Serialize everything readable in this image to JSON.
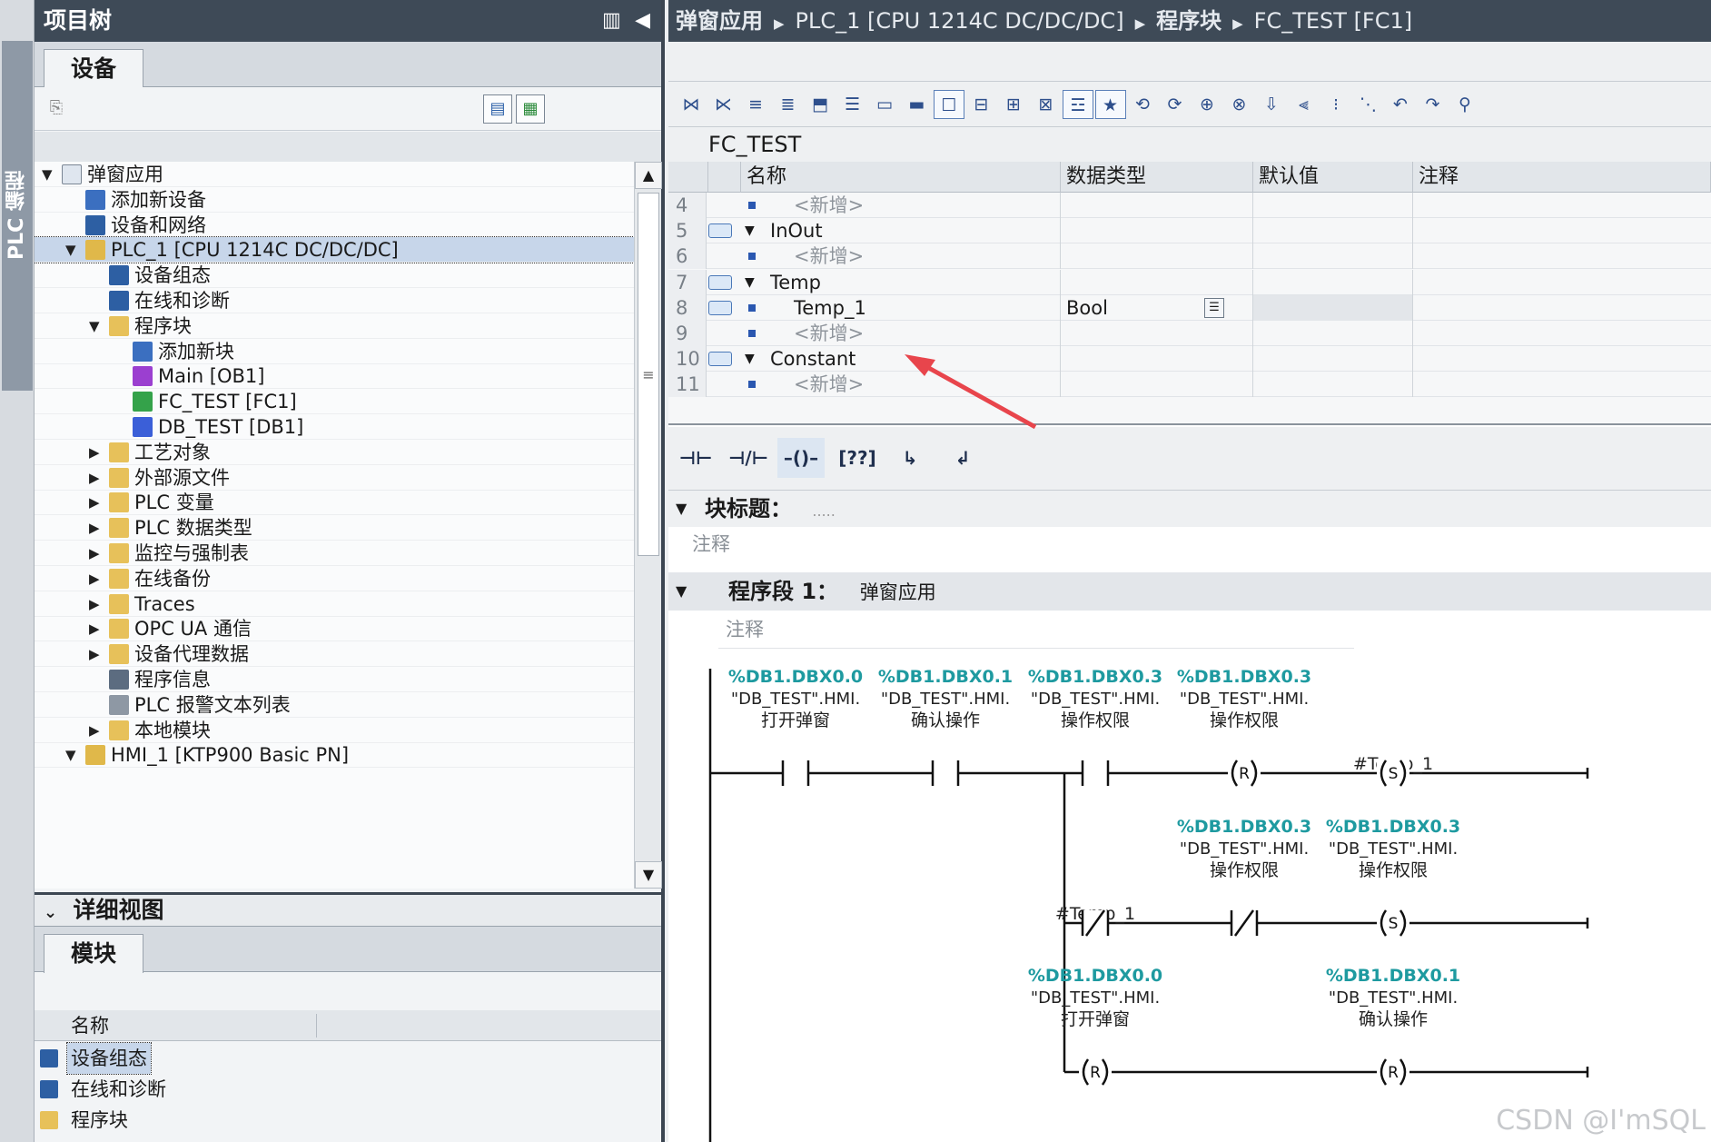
{
  "side_tab": {
    "label": "PLC 编程"
  },
  "project_tree": {
    "title": "项目树",
    "tab_label": "设备",
    "items": [
      {
        "label": "弹窗应用",
        "level": 0,
        "arrow": "▼",
        "icon": "project-icon"
      },
      {
        "label": "添加新设备",
        "level": 1,
        "arrow": "",
        "icon": "add-device-icon"
      },
      {
        "label": "设备和网络",
        "level": 1,
        "arrow": "",
        "icon": "network-icon"
      },
      {
        "label": "PLC_1 [CPU 1214C DC/DC/DC]",
        "level": 1,
        "arrow": "▼",
        "icon": "plc-icon"
      },
      {
        "label": "设备组态",
        "level": 2,
        "arrow": "",
        "icon": "device-config-icon"
      },
      {
        "label": "在线和诊断",
        "level": 2,
        "arrow": "",
        "icon": "diagnostics-icon"
      },
      {
        "label": "程序块",
        "level": 2,
        "arrow": "▼",
        "icon": "folder-icon"
      },
      {
        "label": "添加新块",
        "level": 3,
        "arrow": "",
        "icon": "add-block-icon"
      },
      {
        "label": "Main [OB1]",
        "level": 3,
        "arrow": "",
        "icon": "ob-icon"
      },
      {
        "label": "FC_TEST [FC1]",
        "level": 3,
        "arrow": "",
        "icon": "fc-icon"
      },
      {
        "label": "DB_TEST [DB1]",
        "level": 3,
        "arrow": "",
        "icon": "db-icon"
      },
      {
        "label": "工艺对象",
        "level": 2,
        "arrow": "▶",
        "icon": "folder-icon"
      },
      {
        "label": "外部源文件",
        "level": 2,
        "arrow": "▶",
        "icon": "folder-icon"
      },
      {
        "label": "PLC 变量",
        "level": 2,
        "arrow": "▶",
        "icon": "folder-icon"
      },
      {
        "label": "PLC 数据类型",
        "level": 2,
        "arrow": "▶",
        "icon": "folder-icon"
      },
      {
        "label": "监控与强制表",
        "level": 2,
        "arrow": "▶",
        "icon": "folder-icon"
      },
      {
        "label": "在线备份",
        "level": 2,
        "arrow": "▶",
        "icon": "folder-icon"
      },
      {
        "label": "Traces",
        "level": 2,
        "arrow": "▶",
        "icon": "folder-icon"
      },
      {
        "label": "OPC UA 通信",
        "level": 2,
        "arrow": "▶",
        "icon": "folder-icon"
      },
      {
        "label": "设备代理数据",
        "level": 2,
        "arrow": "▶",
        "icon": "folder-icon"
      },
      {
        "label": "程序信息",
        "level": 2,
        "arrow": "",
        "icon": "program-info-icon"
      },
      {
        "label": "PLC 报警文本列表",
        "level": 2,
        "arrow": "",
        "icon": "alarm-text-icon"
      },
      {
        "label": "本地模块",
        "level": 2,
        "arrow": "▶",
        "icon": "folder-icon"
      },
      {
        "label": "HMI_1 [KTP900 Basic PN]",
        "level": 1,
        "arrow": "▼",
        "icon": "hmi-icon"
      }
    ]
  },
  "detail_view": {
    "title": "详细视图",
    "tab_label": "模块",
    "column_name": "名称",
    "items": [
      {
        "label": "设备组态",
        "icon": "device-config-icon"
      },
      {
        "label": "在线和诊断",
        "icon": "diagnostics-icon"
      },
      {
        "label": "程序块",
        "icon": "folder-icon"
      }
    ]
  },
  "breadcrumb": [
    "弹窗应用",
    "PLC_1 [CPU 1214C DC/DC/DC]",
    "程序块",
    "FC_TEST [FC1]"
  ],
  "block_name": "FC_TEST",
  "interface": {
    "columns": [
      "名称",
      "数据类型",
      "默认值",
      "注释"
    ],
    "rows": [
      {
        "num": "4",
        "pin": false,
        "tri": false,
        "name": "<新增>",
        "indent": 2,
        "placeholder": true,
        "type": ""
      },
      {
        "num": "5",
        "pin": true,
        "tri": true,
        "name": "InOut",
        "indent": 1,
        "placeholder": false,
        "type": ""
      },
      {
        "num": "6",
        "pin": false,
        "tri": false,
        "name": "<新增>",
        "indent": 2,
        "placeholder": true,
        "type": ""
      },
      {
        "num": "7",
        "pin": true,
        "tri": true,
        "name": "Temp",
        "indent": 1,
        "placeholder": false,
        "type": ""
      },
      {
        "num": "8",
        "pin": true,
        "tri": false,
        "name": "Temp_1",
        "indent": 2,
        "placeholder": false,
        "type": "Bool"
      },
      {
        "num": "9",
        "pin": false,
        "tri": false,
        "name": "<新增>",
        "indent": 2,
        "placeholder": true,
        "type": ""
      },
      {
        "num": "10",
        "pin": true,
        "tri": true,
        "name": "Constant",
        "indent": 1,
        "placeholder": false,
        "type": ""
      },
      {
        "num": "11",
        "pin": false,
        "tri": false,
        "name": "<新增>",
        "indent": 2,
        "placeholder": true,
        "type": ""
      }
    ]
  },
  "lad_palette": [
    "normally-open-contact",
    "normally-closed-contact",
    "output-coil",
    "empty-box",
    "open-branch",
    "close-branch"
  ],
  "block_title": {
    "label": "块标题：",
    "value": "....."
  },
  "block_comment": "注释",
  "network": {
    "title": "程序段 1：",
    "name": "弹窗应用",
    "comment": "注释",
    "elements": [
      {
        "kind": "NO",
        "addr": "%DB1.DBX0.0",
        "sym": "\"DB_TEST\".HMI.",
        "desc": "打开弹窗"
      },
      {
        "kind": "NO",
        "addr": "%DB1.DBX0.1",
        "sym": "\"DB_TEST\".HMI.",
        "desc": "确认操作"
      },
      {
        "kind": "NO",
        "addr": "%DB1.DBX0.3",
        "sym": "\"DB_TEST\".HMI.",
        "desc": "操作权限"
      },
      {
        "kind": "R",
        "addr": "%DB1.DBX0.3",
        "sym": "\"DB_TEST\".HMI.",
        "desc": "操作权限"
      },
      {
        "kind": "S",
        "addr": "",
        "sym": "",
        "desc": "#Temp_1"
      },
      {
        "kind": "NC",
        "addr": "",
        "sym": "",
        "desc": "#Temp_1"
      },
      {
        "kind": "NC",
        "addr": "%DB1.DBX0.3",
        "sym": "\"DB_TEST\".HMI.",
        "desc": "操作权限"
      },
      {
        "kind": "S",
        "addr": "%DB1.DBX0.3",
        "sym": "\"DB_TEST\".HMI.",
        "desc": "操作权限"
      },
      {
        "kind": "R",
        "addr": "%DB1.DBX0.0",
        "sym": "\"DB_TEST\".HMI.",
        "desc": "打开弹窗"
      },
      {
        "kind": "R",
        "addr": "%DB1.DBX0.1",
        "sym": "\"DB_TEST\".HMI.",
        "desc": "确认操作"
      }
    ]
  },
  "watermark": "CSDN @I'mSQL",
  "colors": {
    "address": "#1e9aa0",
    "header_dark": "#3e4a57",
    "annotation_arrow": "#e8454c"
  }
}
